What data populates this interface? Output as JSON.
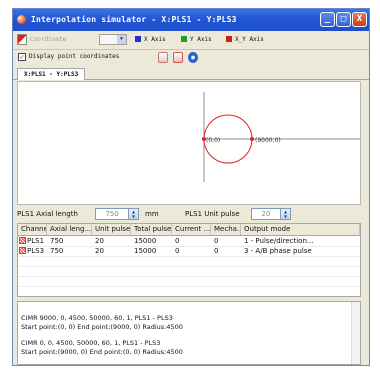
{
  "window": {
    "title": "Interpolation simulator - X:PLS1 - Y:PLS3",
    "buttons": {
      "minimize": "_",
      "maximize": "□",
      "close": "X"
    }
  },
  "toolbar": {
    "coordinate_label": "Coordinate",
    "legend": [
      {
        "label": "X Axis",
        "color": "#1f2fd0"
      },
      {
        "label": "Y Axis",
        "color": "#1fa01f"
      },
      {
        "label": "X_Y Axis",
        "color": "#d21d1d"
      }
    ]
  },
  "options": {
    "display_point_coordinates": "Display point coordinates",
    "checked": true
  },
  "tab": {
    "label": "X:PLS1 - Y:PLS3"
  },
  "plot": {
    "circle_color": "#e02020",
    "axis_color": "#909090",
    "start_label": "(0,0)",
    "end_label": "(9000,0)"
  },
  "axial": {
    "length_label": "PLS1 Axial length",
    "length_value": "750",
    "unit_mm": "mm",
    "pulse_label": "PLS1 Unit pulse",
    "pulse_value": "20"
  },
  "table": {
    "columns": [
      "Channel",
      "Axial leng...",
      "Unit pulse",
      "Total pulse",
      "Current ...",
      "Mecha...",
      "Output mode"
    ],
    "rows": [
      [
        "PLS1",
        "750",
        "20",
        "15000",
        "0",
        "0",
        "1 - Pulse/direction..."
      ],
      [
        "PLS3",
        "750",
        "20",
        "15000",
        "0",
        "0",
        "3 - A/B phase pulse"
      ]
    ]
  },
  "log": {
    "entries": [
      {
        "command": "CIMR  9000, 0, 4500, 50000, 60, 1, PLS1 - PLS3",
        "detail": "Start point:(0, 0)    End point:(9000, 0)    Radius:4500"
      },
      {
        "command": "CIMR  0, 0, 4500, 50000, 60, 1, PLS1 - PLS3",
        "detail": "Start point:(9000, 0)    End point:(0, 0)    Radius:4500"
      }
    ]
  }
}
